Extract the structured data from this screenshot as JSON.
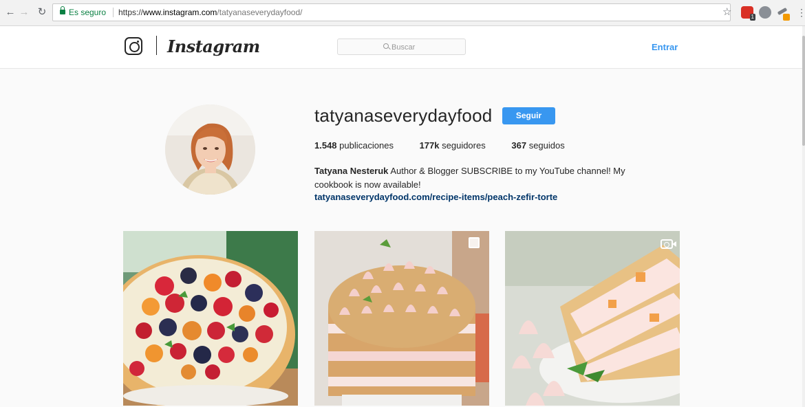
{
  "browser": {
    "secure_label": "Es seguro",
    "url_scheme": "https://",
    "url_host": "www.instagram.com",
    "url_path": "/tatyanaseverydayfood/",
    "extension_badge": "1",
    "icons": [
      "back-arrow-icon",
      "forward-arrow-icon",
      "reload-icon",
      "lock-icon",
      "star-icon",
      "extension-icon",
      "menu-icon"
    ]
  },
  "header": {
    "wordmark": "Instagram",
    "search_placeholder": "Buscar",
    "login_label": "Entrar"
  },
  "profile": {
    "username": "tatyanaseverydayfood",
    "follow_label": "Seguir",
    "posts_count": "1.548",
    "posts_label": "publicaciones",
    "followers_count": "177k",
    "followers_label": "seguidores",
    "following_count": "367",
    "following_label": "seguidos",
    "full_name": "Tatyana Nesteruk",
    "bio_text": "Author & Blogger SUBSCRIBE to my YouTube channel! My cookbook is now available!",
    "website": "tatyanaseverydayfood.com/recipe-items/peach-zefir-torte"
  },
  "posts": [
    {
      "subject": "berry tart",
      "type": "photo"
    },
    {
      "subject": "peach zefir torte",
      "type": "carousel"
    },
    {
      "subject": "layered peach cake slice",
      "type": "video"
    }
  ],
  "colors": {
    "accent": "#3897f0",
    "link": "#003569",
    "secure": "#0b8043"
  }
}
